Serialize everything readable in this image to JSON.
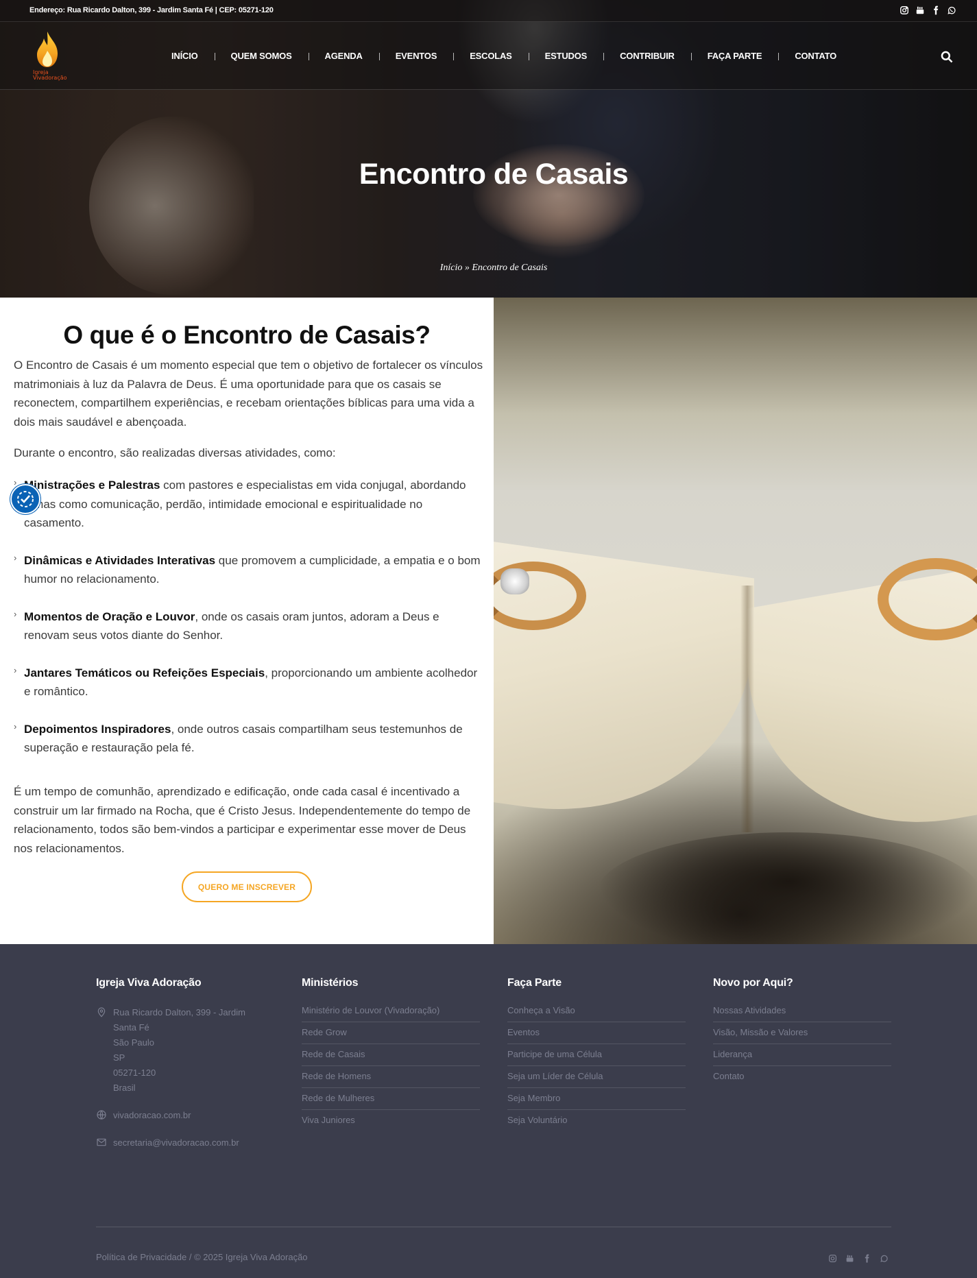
{
  "topbar": {
    "address": "Endereço: Rua Ricardo Dalton, 399 - Jardim Santa Fé | CEP: 05271-120",
    "social": [
      "instagram-icon",
      "youtube-icon",
      "facebook-icon",
      "whatsapp-icon"
    ]
  },
  "header": {
    "logo_text": "Igreja Vivadoração",
    "nav": [
      "INÍCIO",
      "QUEM SOMOS",
      "AGENDA",
      "EVENTOS",
      "ESCOLAS",
      "ESTUDOS",
      "CONTRIBUIR",
      "FAÇA PARTE",
      "CONTATO"
    ]
  },
  "hero": {
    "title": "Encontro de Casais",
    "breadcrumb": "Início » Encontro de Casais"
  },
  "main": {
    "title": "O que é o Encontro de Casais?",
    "intro": "O Encontro de Casais é um momento especial que tem o objetivo de fortalecer os vínculos matrimoniais à luz da Palavra de Deus. É uma oportunidade para que os casais se reconectem, compartilhem experiências, e recebam orientações bíblicas para uma vida a dois mais saudável e abençoada.",
    "activities_intro": "Durante o encontro, são realizadas diversas atividades, como:",
    "bullets": [
      {
        "bold": "Ministrações e Palestras",
        "text": " com pastores e especialistas em vida conjugal, abordando temas como comunicação, perdão, intimidade emocional e espiritualidade no casamento."
      },
      {
        "bold": "Dinâmicas e Atividades Interativas",
        "text": " que promovem a cumplicidade, a empatia e o bom humor no relacionamento."
      },
      {
        "bold": "Momentos de Oração e Louvor",
        "text": ", onde os casais oram juntos, adoram a Deus e renovam seus votos diante do Senhor."
      },
      {
        "bold": "Jantares Temáticos ou Refeições Especiais",
        "text": ", proporcionando um ambiente acolhedor e romântico."
      },
      {
        "bold": "Depoimentos Inspiradores",
        "text": ", onde outros casais compartilham seus testemunhos de superação e restauração pela fé."
      }
    ],
    "closing": "É um tempo de comunhão, aprendizado e edificação, onde cada casal é incentivado a construir um lar firmado na Rocha, que é Cristo Jesus. Independentemente do tempo de relacionamento, todos são bem-vindos a participar e experimentar esse mover de Deus nos relacionamentos.",
    "cta": "QUERO ME INSCREVER"
  },
  "footer": {
    "col1": {
      "title": "Igreja Viva Adoração",
      "address_lines": [
        "Rua Ricardo Dalton, 399 - Jardim",
        "Santa Fé",
        "São Paulo",
        "SP",
        "05271-120",
        "Brasil"
      ],
      "website": "vivadoracao.com.br",
      "email": "secretaria@vivadoracao.com.br"
    },
    "col2": {
      "title": "Ministérios",
      "links": [
        "Ministério de Louvor (Vivadoração)",
        "Rede Grow",
        "Rede de Casais",
        "Rede de Homens",
        "Rede de Mulheres",
        "Viva Juniores"
      ]
    },
    "col3": {
      "title": "Faça Parte",
      "links": [
        "Conheça a Visão",
        "Eventos",
        "Participe de uma Célula",
        "Seja um Líder de Célula",
        "Seja Membro",
        "Seja Voluntário"
      ]
    },
    "col4": {
      "title": "Novo por Aqui?",
      "links": [
        "Nossas Atividades",
        "Visão, Missão e Valores",
        "Liderança",
        "Contato"
      ]
    },
    "copyright": "Política de Privacidade / © 2025 Igreja Viva Adoração"
  },
  "colors": {
    "accent": "#f5a623",
    "footer_bg": "#3b3d4c",
    "accessibility_blue": "#0a62b5"
  }
}
